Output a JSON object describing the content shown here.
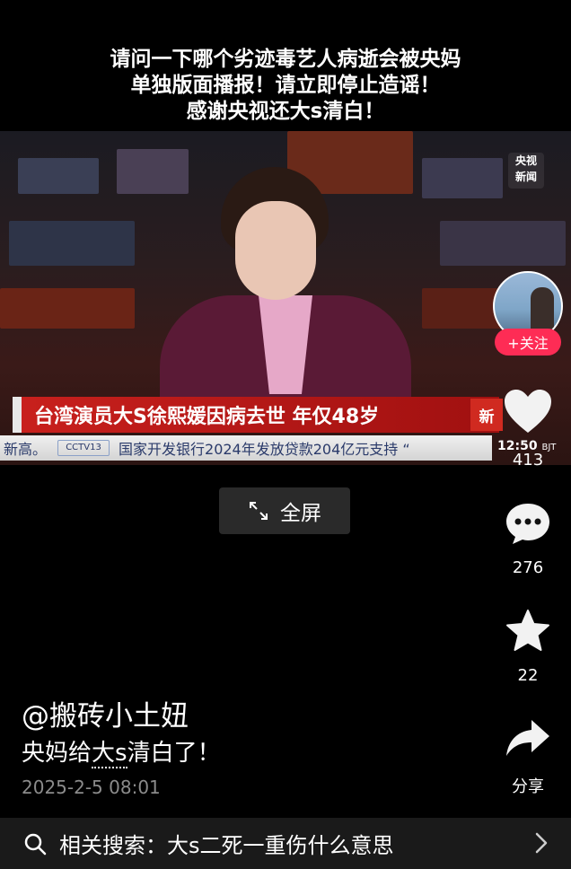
{
  "caption": {
    "line1": "请问一下哪个劣迹毒艺人病逝会被央妈",
    "line2": "单独版面播报！请立即停止造谣！",
    "line3": "感谢央视还大s清白！"
  },
  "video": {
    "logo_line1": "央视",
    "logo_line2": "新闻",
    "headline": "台湾演员大S徐熙媛因病去世  年仅48岁",
    "headline_tag": "新",
    "ticker_left": "新高。",
    "ticker_channel": "CCTV13",
    "ticker_text": "国家开发银行2024年发放贷款204亿元支持 “",
    "time": "12:50",
    "time_zone": "BJT",
    "fullscreen_label": "全屏"
  },
  "sidebar": {
    "follow_label": "+关注",
    "likes": "413",
    "comments": "276",
    "favorites": "22",
    "share_label": "分享"
  },
  "post": {
    "author": "@搬砖小土妞",
    "desc_before": "央妈给",
    "desc_keyword": "大s",
    "desc_after": "清白了！",
    "date": "2025-2-5 08:01"
  },
  "search": {
    "text": "相关搜索：大s二死一重伤什么意思"
  },
  "colors": {
    "accent": "#fe2c55",
    "headline_red": "#c8201d",
    "background": "#000000"
  }
}
